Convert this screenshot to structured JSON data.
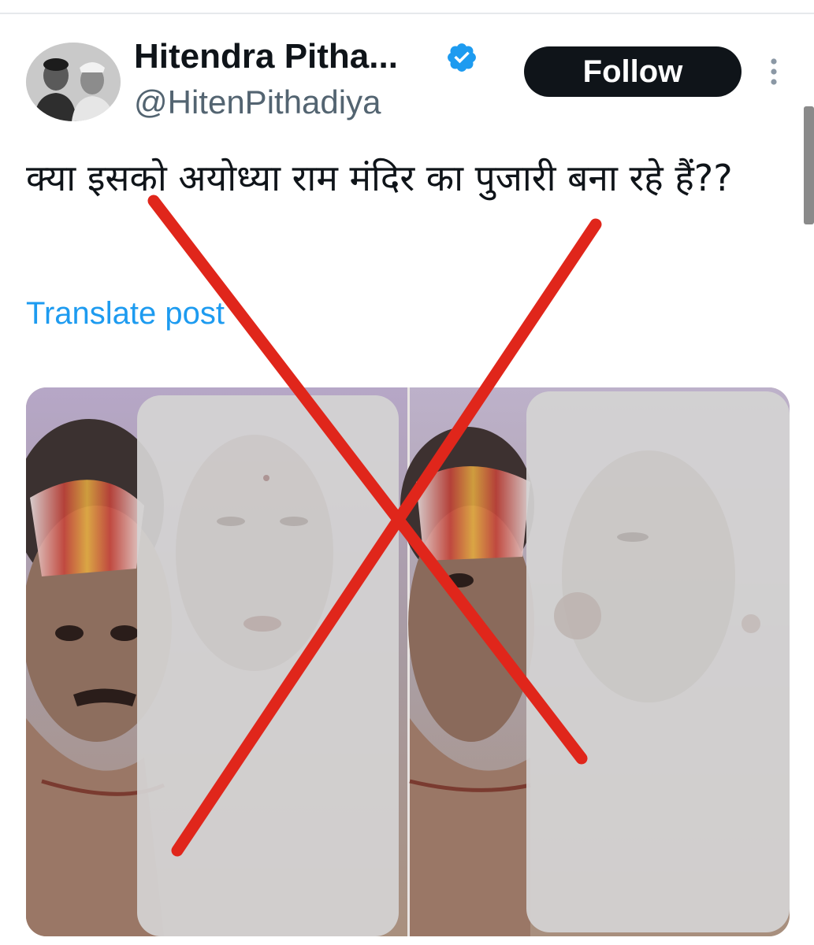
{
  "author": {
    "display_name": "Hitendra Pitha...",
    "handle": "@HitenPithadiya",
    "verified": true,
    "avatar_icon": "avatar-photo"
  },
  "actions": {
    "follow_label": "Follow",
    "more_icon": "more-vertical-icon"
  },
  "tweet": {
    "text": "क्या इसको अयोध्या राम मंदिर का पुजारी बना रहे हैं??",
    "translate_label": "Translate post"
  },
  "media": {
    "panels": 2,
    "overlay": "red-cross"
  },
  "colors": {
    "follow_bg": "#0f1419",
    "link": "#1d9bf0",
    "verified": "#1d9bf0",
    "cross": "#e0261b",
    "handle": "#536471"
  }
}
